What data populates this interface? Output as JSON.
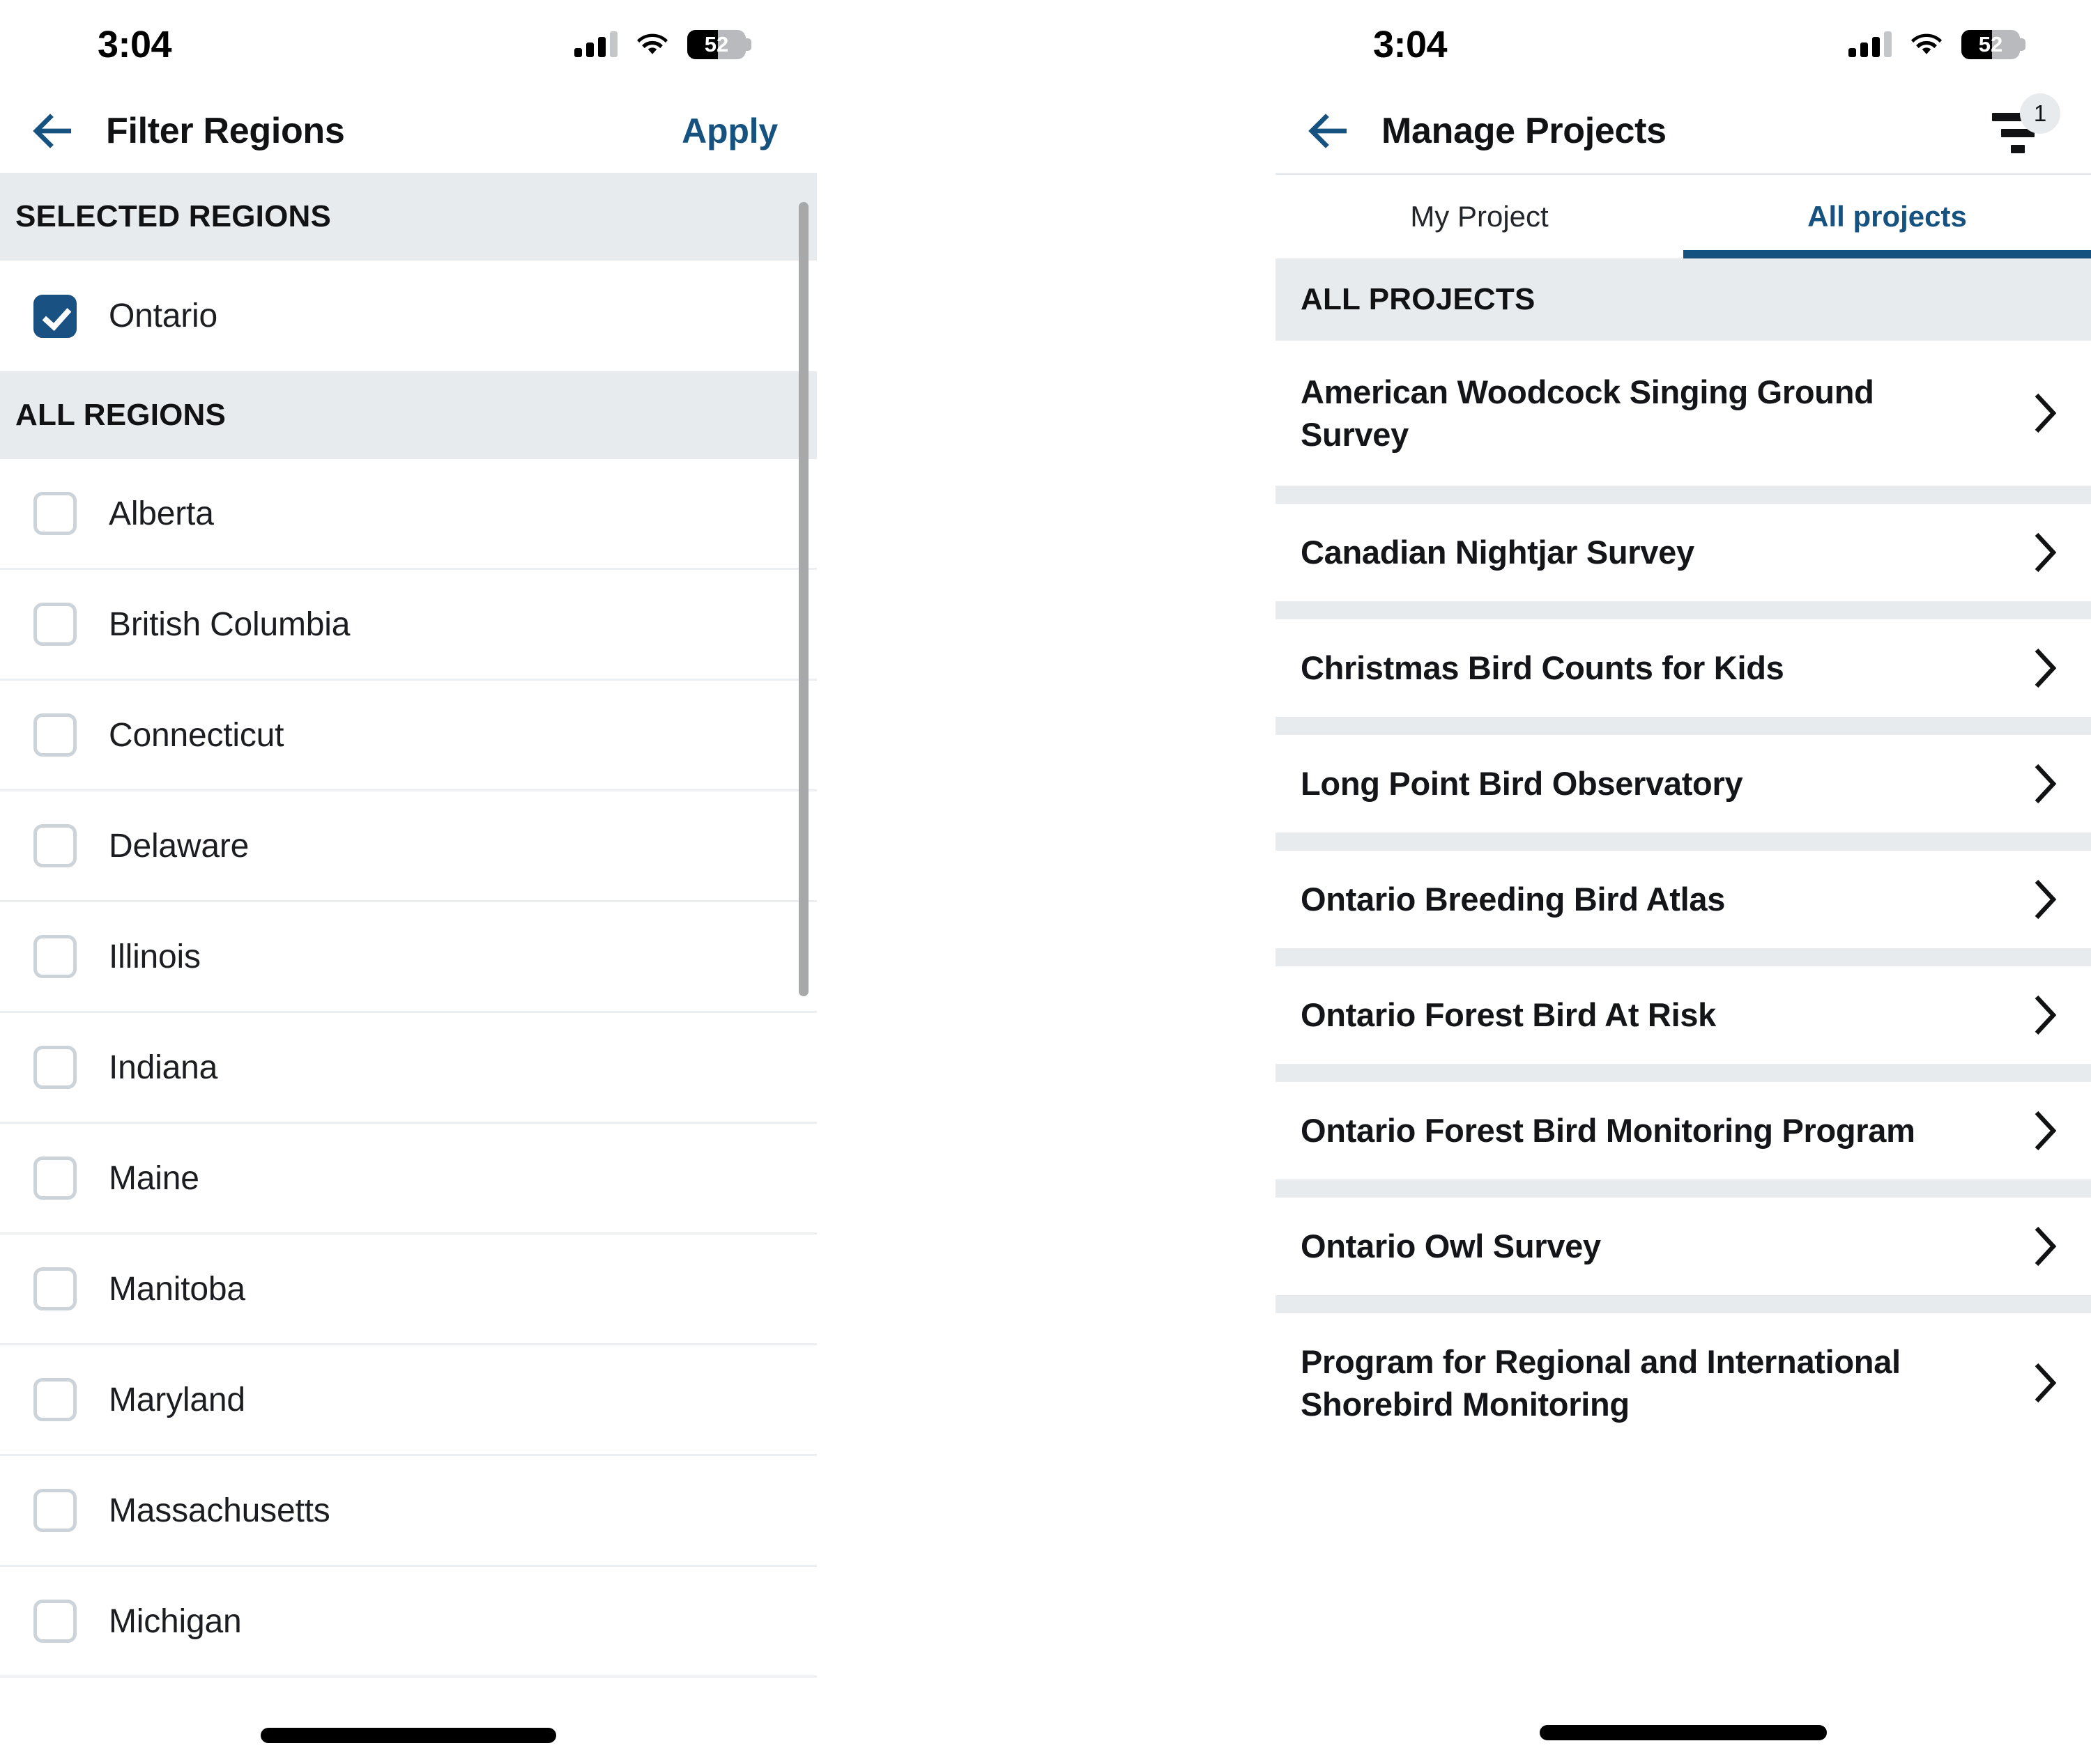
{
  "colors": {
    "accent_blue": "#16527F",
    "checkbox_checked": "#1A5183",
    "section_bg": "#E7EBEE",
    "divider": "#ECEFF1",
    "text_primary": "#131518",
    "checkbox_border": "#CCD3D9"
  },
  "left_screen": {
    "status_bar": {
      "time": "3:04",
      "battery_level": "52",
      "signal_icon": "cellular-signal-icon",
      "wifi_icon": "wifi-icon",
      "battery_icon": "battery-icon"
    },
    "nav": {
      "back_icon": "back-arrow-icon",
      "title": "Filter Regions",
      "action_label": "Apply"
    },
    "selected_section": {
      "header": "SELECTED REGIONS",
      "items": [
        {
          "label": "Ontario",
          "checked": true
        }
      ]
    },
    "all_section": {
      "header": "ALL REGIONS",
      "items": [
        {
          "label": "Alberta",
          "checked": false
        },
        {
          "label": "British Columbia",
          "checked": false
        },
        {
          "label": "Connecticut",
          "checked": false
        },
        {
          "label": "Delaware",
          "checked": false
        },
        {
          "label": "Illinois",
          "checked": false
        },
        {
          "label": "Indiana",
          "checked": false
        },
        {
          "label": "Maine",
          "checked": false
        },
        {
          "label": "Manitoba",
          "checked": false
        },
        {
          "label": "Maryland",
          "checked": false
        },
        {
          "label": "Massachusetts",
          "checked": false
        },
        {
          "label": "Michigan",
          "checked": false
        }
      ]
    },
    "scrollbar": {
      "name": "vertical-scrollbar"
    },
    "home_indicator": "home-indicator"
  },
  "right_screen": {
    "status_bar": {
      "time": "3:04",
      "battery_level": "52",
      "signal_icon": "cellular-signal-icon",
      "wifi_icon": "wifi-icon",
      "battery_icon": "battery-icon"
    },
    "nav": {
      "back_icon": "back-arrow-icon",
      "title": "Manage Projects",
      "filter_icon": "filter-icon",
      "filter_badge_count": "1"
    },
    "tabs": [
      {
        "label": "My Project",
        "active": false
      },
      {
        "label": "All projects",
        "active": true
      }
    ],
    "section": {
      "header": "ALL PROJECTS"
    },
    "projects": [
      {
        "title": "American Woodcock Singing Ground Survey"
      },
      {
        "title": "Canadian Nightjar Survey"
      },
      {
        "title": "Christmas Bird Counts for Kids"
      },
      {
        "title": "Long Point Bird Observatory"
      },
      {
        "title": "Ontario Breeding Bird Atlas"
      },
      {
        "title": "Ontario Forest Bird At Risk"
      },
      {
        "title": "Ontario Forest Bird Monitoring Program"
      },
      {
        "title": "Ontario Owl Survey"
      },
      {
        "title": "Program for Regional and International Shorebird Monitoring"
      }
    ],
    "home_indicator": "home-indicator"
  }
}
